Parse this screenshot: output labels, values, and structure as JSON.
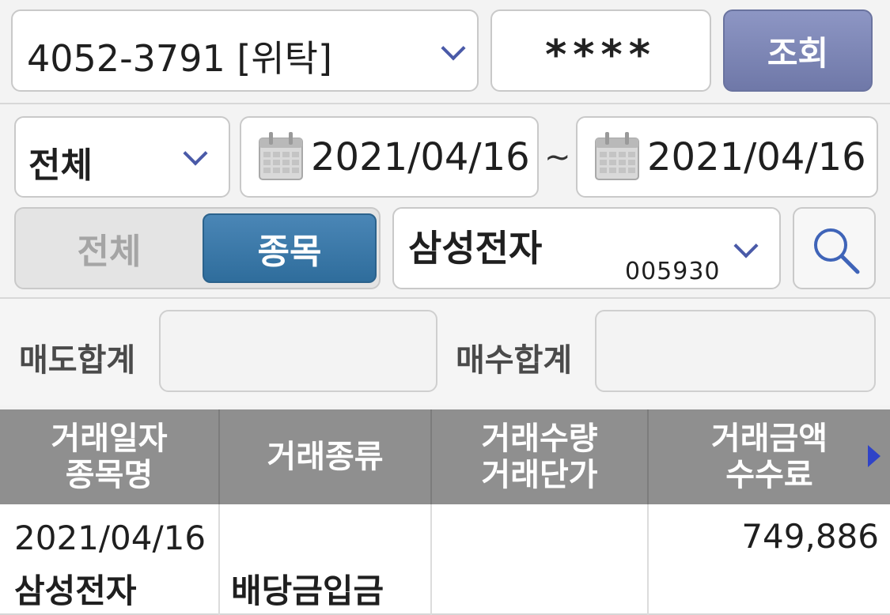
{
  "account": {
    "selected": "4052-3791 [위탁]",
    "password_mask": "****"
  },
  "query_button": {
    "label": "조회"
  },
  "filter": {
    "type_selected": "전체",
    "date_from": "2021/04/16",
    "date_separator": "~",
    "date_to": "2021/04/16"
  },
  "toggle": {
    "all_label": "전체",
    "stock_label": "종목",
    "active": "종목"
  },
  "stock": {
    "name": "삼성전자",
    "code": "005930"
  },
  "summary": {
    "sell_label": "매도합계",
    "sell_value": "",
    "buy_label": "매수합계",
    "buy_value": ""
  },
  "table": {
    "headers": [
      {
        "line1": "거래일자",
        "line2": "종목명"
      },
      {
        "line1": "거래종류",
        "line2": ""
      },
      {
        "line1": "거래수량",
        "line2": "거래단가"
      },
      {
        "line1": "거래금액",
        "line2": "수수료"
      }
    ],
    "rows": [
      {
        "date": "2021/04/16",
        "stock_name": "삼성전자",
        "trade_type": "배당금입금",
        "quantity": "",
        "unit_price": "",
        "amount": "749,886",
        "fee": ""
      }
    ]
  },
  "colors": {
    "accent_primary": "#2f6d9c",
    "query_button": "#7e87b6",
    "header_bg": "#8f8f8f",
    "chevron": "#4a5aa8"
  }
}
